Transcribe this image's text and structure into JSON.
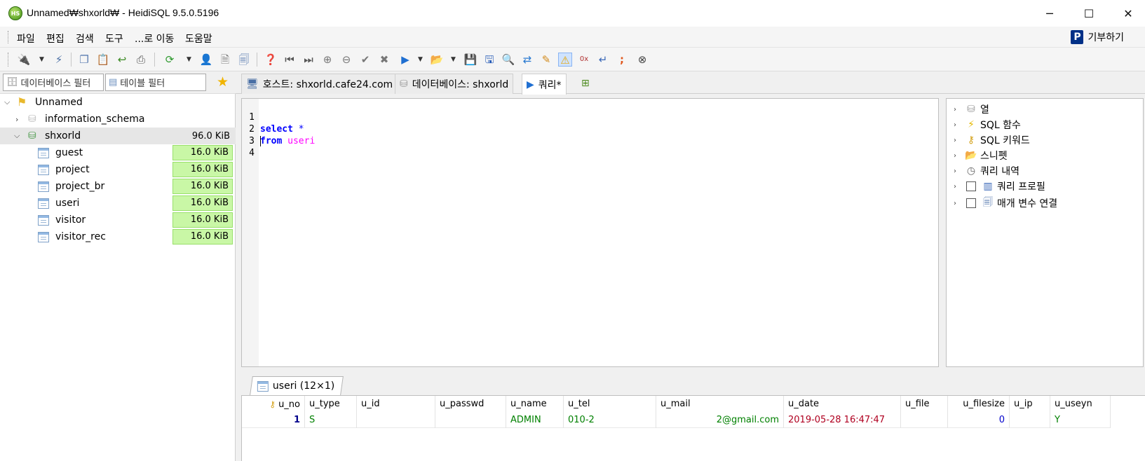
{
  "window": {
    "title": "Unnamed₩shxorld₩ - HeidiSQL 9.5.0.5196",
    "app_icon_text": "HS",
    "minimize": "─",
    "maximize": "☐",
    "close": "✕"
  },
  "menu": {
    "items": [
      "파일",
      "편집",
      "검색",
      "도구",
      "...로 이동",
      "도움말"
    ],
    "donate_label": "기부하기",
    "donate_icon": "P"
  },
  "toolbar": {
    "icons": [
      "connect-icon",
      "disconnect-icon",
      "copy-icon",
      "paste-icon",
      "undo-icon",
      "print-icon",
      "refresh-icon",
      "user-manager-icon",
      "export-icon",
      "import-icon",
      "help-icon",
      "first-icon",
      "last-icon",
      "add-row-icon",
      "delete-row-icon",
      "post-icon",
      "cancel-icon",
      "run-icon",
      "load-sql-icon",
      "save-icon",
      "save-as-icon",
      "find-icon",
      "replace-icon",
      "format-icon",
      "warnings-icon",
      "binary-icon",
      "wrap-icon",
      "semicolon-icon",
      "stop-icon"
    ]
  },
  "filters": {
    "db_filter_placeholder": "데이터베이스 필터",
    "table_filter_placeholder": "테이블 필터"
  },
  "tree": {
    "root": "Unnamed",
    "databases": [
      {
        "name": "information_schema",
        "size": ""
      },
      {
        "name": "shxorld",
        "size": "96.0 KiB"
      }
    ],
    "tables": [
      {
        "name": "guest",
        "size": "16.0 KiB"
      },
      {
        "name": "project",
        "size": "16.0 KiB"
      },
      {
        "name": "project_br",
        "size": "16.0 KiB"
      },
      {
        "name": "useri",
        "size": "16.0 KiB"
      },
      {
        "name": "visitor",
        "size": "16.0 KiB"
      },
      {
        "name": "visitor_rec",
        "size": "16.0 KiB"
      }
    ]
  },
  "tabs": [
    {
      "label": "호스트: shxorld.cafe24.com"
    },
    {
      "label": "데이터베이스: shxorld"
    },
    {
      "label": "쿼리*"
    }
  ],
  "editor": {
    "lines": [
      {
        "n": "1",
        "kw": "select",
        "rest": "*"
      },
      {
        "n": "2",
        "kw": "from",
        "rest": "useri"
      },
      {
        "n": "3",
        "kw": "",
        "rest": ""
      },
      {
        "n": "4",
        "kw": "",
        "rest": ""
      }
    ]
  },
  "helpers": {
    "items": [
      "열",
      "SQL 함수",
      "SQL 키워드",
      "스니펫",
      "쿼리 내역",
      "쿼리 프로필",
      "매개 변수 연결"
    ]
  },
  "result": {
    "tab_label": "useri (12×1)",
    "columns": [
      "u_no",
      "u_type",
      "u_id",
      "u_passwd",
      "u_name",
      "u_tel",
      "u_mail",
      "u_date",
      "u_file",
      "u_filesize",
      "u_ip",
      "u_useyn"
    ],
    "row": {
      "u_no": "1",
      "u_type": "S",
      "u_id": "",
      "u_passwd": "",
      "u_name": "ADMIN",
      "u_tel": "010-2",
      "u_mail": "2@gmail.com",
      "u_date": "2019-05-28 16:47:47",
      "u_file": "",
      "u_filesize": "0",
      "u_ip": "",
      "u_useyn": "Y"
    }
  },
  "colors": {
    "keyword": "#0000ff",
    "table_name": "#ff00ff",
    "size_bar": "#c9f7a6",
    "selection": "#e6e6e6"
  }
}
